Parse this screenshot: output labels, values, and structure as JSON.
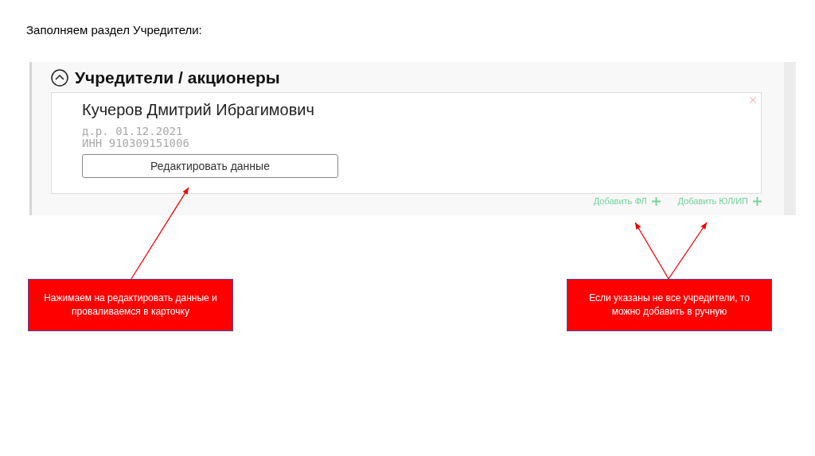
{
  "slide_title": "Заполняем раздел Учредители:",
  "section": {
    "title": "Учредители / акционеры",
    "expanded": true,
    "founders": [
      {
        "name": "Кучеров Дмитрий Ибрагимович",
        "birth": "д.р. 01.12.2021",
        "inn_label": "ИНН",
        "inn": "910309151006",
        "edit_button": "Редактировать данные"
      }
    ],
    "add_links": [
      "Добавить ФЛ",
      "Добавить ЮЛ/ИП"
    ]
  },
  "callouts": [
    {
      "text": "Нажимаем на редактировать данные и проваливаемся в карточку"
    },
    {
      "text": "Если указаны не все учредители, то можно добавить в ручную"
    }
  ]
}
